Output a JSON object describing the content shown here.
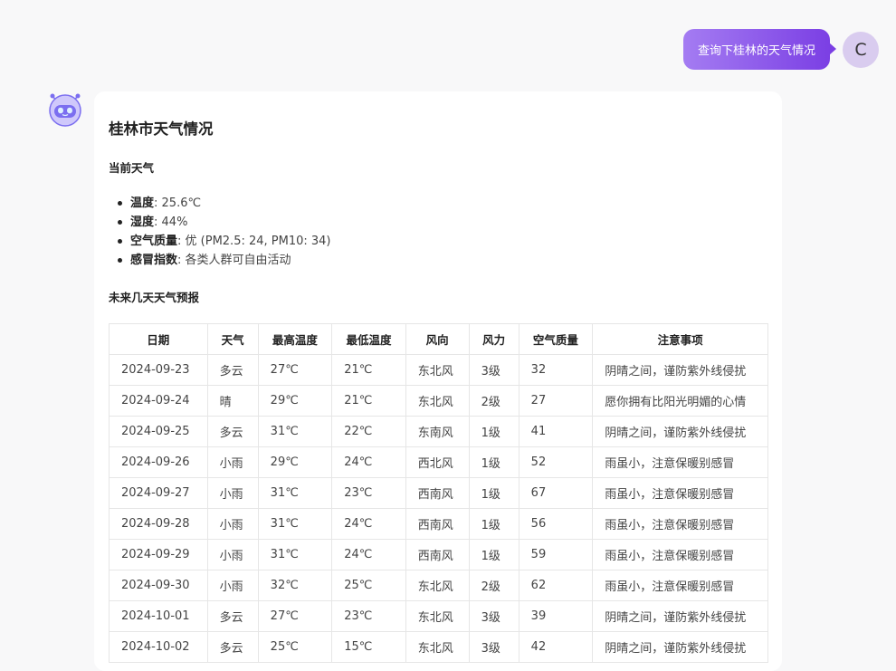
{
  "user_message": {
    "text": "查询下桂林的天气情况",
    "avatar_initial": "C"
  },
  "bot_message": {
    "title": "桂林市天气情况",
    "current_heading": "当前天气",
    "current": [
      {
        "label": "温度",
        "value": ": 25.6℃"
      },
      {
        "label": "湿度",
        "value": ": 44%"
      },
      {
        "label": "空气质量",
        "value": ": 优 (PM2.5: 24, PM10: 34)"
      },
      {
        "label": "感冒指数",
        "value": ": 各类人群可自由活动"
      }
    ],
    "forecast_heading": "未来几天天气预报",
    "table": {
      "headers": [
        "日期",
        "天气",
        "最高温度",
        "最低温度",
        "风向",
        "风力",
        "空气质量",
        "注意事项"
      ],
      "rows": [
        [
          "2024-09-23",
          "多云",
          "27℃",
          "21℃",
          "东北风",
          "3级",
          "32",
          "阴晴之间，谨防紫外线侵扰"
        ],
        [
          "2024-09-24",
          "晴",
          "29℃",
          "21℃",
          "东北风",
          "2级",
          "27",
          "愿你拥有比阳光明媚的心情"
        ],
        [
          "2024-09-25",
          "多云",
          "31℃",
          "22℃",
          "东南风",
          "1级",
          "41",
          "阴晴之间，谨防紫外线侵扰"
        ],
        [
          "2024-09-26",
          "小雨",
          "29℃",
          "24℃",
          "西北风",
          "1级",
          "52",
          "雨虽小，注意保暖别感冒"
        ],
        [
          "2024-09-27",
          "小雨",
          "31℃",
          "23℃",
          "西南风",
          "1级",
          "67",
          "雨虽小，注意保暖别感冒"
        ],
        [
          "2024-09-28",
          "小雨",
          "31℃",
          "24℃",
          "西南风",
          "1级",
          "56",
          "雨虽小，注意保暖别感冒"
        ],
        [
          "2024-09-29",
          "小雨",
          "31℃",
          "24℃",
          "西南风",
          "1级",
          "59",
          "雨虽小，注意保暖别感冒"
        ],
        [
          "2024-09-30",
          "小雨",
          "32℃",
          "25℃",
          "东北风",
          "2级",
          "62",
          "雨虽小，注意保暖别感冒"
        ],
        [
          "2024-10-01",
          "多云",
          "27℃",
          "23℃",
          "东北风",
          "3级",
          "39",
          "阴晴之间，谨防紫外线侵扰"
        ],
        [
          "2024-10-02",
          "多云",
          "25℃",
          "15℃",
          "东北风",
          "3级",
          "42",
          "阴晴之间，谨防紫外线侵扰"
        ]
      ]
    }
  },
  "colors": {
    "user_bubble_start": "#a47cf2",
    "user_bubble_end": "#7b3fe4",
    "bot_avatar": "#7b6ef0"
  },
  "icons": {
    "bot_avatar": "robot-icon"
  }
}
